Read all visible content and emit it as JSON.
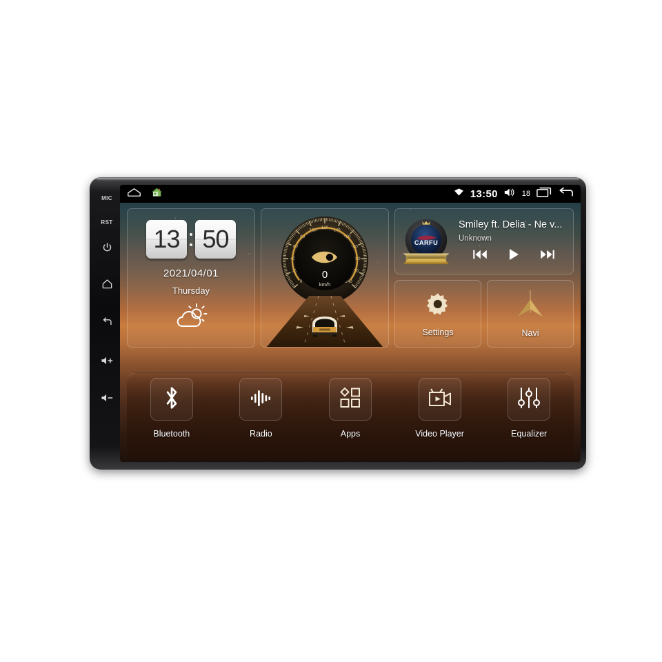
{
  "device": {
    "hardware_buttons": [
      {
        "name": "mic",
        "label": "MIC",
        "type": "text"
      },
      {
        "name": "reset",
        "label": "RST",
        "type": "text"
      },
      {
        "name": "power",
        "label": "power-icon",
        "type": "icon"
      },
      {
        "name": "home",
        "label": "home-icon",
        "type": "icon"
      },
      {
        "name": "back",
        "label": "back-icon",
        "type": "icon"
      },
      {
        "name": "volume-up",
        "label": "volume-up-icon",
        "type": "icon"
      },
      {
        "name": "volume-down",
        "label": "volume-down-icon",
        "type": "icon"
      }
    ]
  },
  "statusbar": {
    "left_icons": [
      "home-outline-icon",
      "home-color-icon"
    ],
    "wifi_icon": "wifi-icon",
    "time": "13:50",
    "volume_icon": "volume-icon",
    "volume_level": "18",
    "recents_icon": "recents-icon",
    "back_icon": "back-arrow-icon"
  },
  "clock_widget": {
    "hours": "13",
    "minutes": "50",
    "date": "2021/04/01",
    "weekday": "Thursday",
    "weather_icon": "partly-cloudy-icon"
  },
  "speedometer": {
    "value": "0",
    "unit": "km/h",
    "ticks": [
      "0",
      "20",
      "40",
      "60",
      "80",
      "100",
      "120",
      "140",
      "160",
      "180",
      "200",
      "220",
      "240"
    ],
    "min": 0,
    "max": 240,
    "accent_color": "#d9a441"
  },
  "media": {
    "album_badge_text": "CARFU",
    "track_title": "Smiley ft. Delia - Ne v...",
    "artist": "Unknown",
    "controls": [
      {
        "name": "previous-track-button",
        "icon": "skip-previous-icon"
      },
      {
        "name": "play-button",
        "icon": "play-icon"
      },
      {
        "name": "next-track-button",
        "icon": "skip-next-icon"
      }
    ]
  },
  "tiles": [
    {
      "name": "settings-tile",
      "label": "Settings",
      "icon": "gear-icon"
    },
    {
      "name": "navi-tile",
      "label": "Navi",
      "icon": "navigation-arrow-icon"
    }
  ],
  "dock": [
    {
      "name": "bluetooth",
      "label": "Bluetooth",
      "icon": "bluetooth-icon"
    },
    {
      "name": "radio",
      "label": "Radio",
      "icon": "radio-waves-icon"
    },
    {
      "name": "apps",
      "label": "Apps",
      "icon": "apps-grid-icon"
    },
    {
      "name": "video-player",
      "label": "Video Player",
      "icon": "video-camera-icon"
    },
    {
      "name": "equalizer",
      "label": "Equalizer",
      "icon": "equalizer-sliders-icon"
    }
  ],
  "colors": {
    "screen_top": "#16313b",
    "screen_sunset": "#c87c3e",
    "screen_bottom": "#1d100a",
    "gauge_gold": "#d9a441",
    "badge_gold": "#e8c96a"
  }
}
